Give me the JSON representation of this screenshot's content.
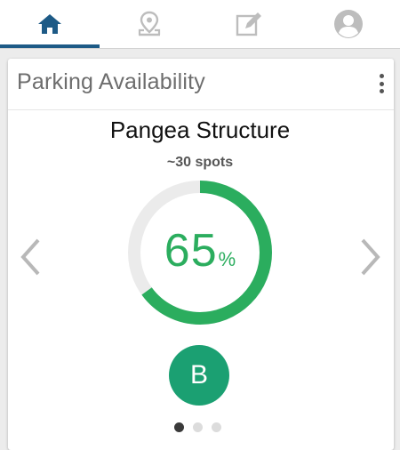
{
  "tabs": [
    {
      "icon": "home-icon",
      "active": true
    },
    {
      "icon": "map-pin-icon",
      "active": false
    },
    {
      "icon": "edit-icon",
      "active": false
    },
    {
      "icon": "profile-icon",
      "active": false
    }
  ],
  "card": {
    "title": "Parking Availability",
    "structure_name": "Pangea Structure",
    "spots": "~30 spots",
    "availability_value": "65",
    "availability_unit": "%",
    "availability_fraction": 0.65,
    "grade": "B"
  },
  "pager": {
    "total": 3,
    "active_index": 0
  },
  "colors": {
    "accent": "#1d5a86",
    "gauge_fill": "#2bad5e",
    "gauge_track": "#ebebeb",
    "grade_badge": "#1ba072"
  }
}
